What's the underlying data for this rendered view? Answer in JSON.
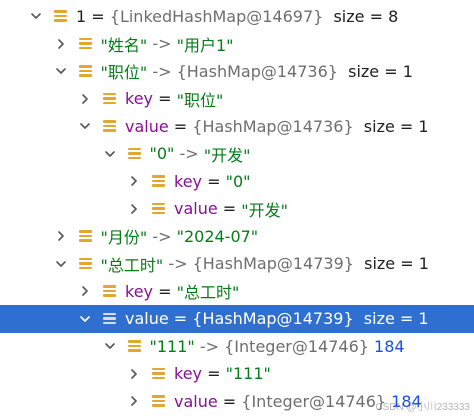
{
  "rows": [
    {
      "indent": 0,
      "expanded": true,
      "selected": false,
      "parts": [
        {
          "t": "1 = ",
          "c": "k-plain"
        },
        {
          "t": "{LinkedHashMap@14697}",
          "c": "k-gray"
        },
        {
          "t": "  size = 8",
          "c": "k-plain"
        }
      ]
    },
    {
      "indent": 1,
      "expanded": false,
      "selected": false,
      "parts": [
        {
          "t": "\"姓名\"",
          "c": "k-str"
        },
        {
          "t": " -> ",
          "c": "k-gray"
        },
        {
          "t": "\"用户1\"",
          "c": "k-str"
        }
      ]
    },
    {
      "indent": 1,
      "expanded": true,
      "selected": false,
      "parts": [
        {
          "t": "\"职位\"",
          "c": "k-str"
        },
        {
          "t": " -> ",
          "c": "k-gray"
        },
        {
          "t": "{HashMap@14736}",
          "c": "k-gray"
        },
        {
          "t": "  size = 1",
          "c": "k-plain"
        }
      ]
    },
    {
      "indent": 2,
      "expanded": false,
      "selected": false,
      "parts": [
        {
          "t": "key",
          "c": "k-key"
        },
        {
          "t": " = ",
          "c": "k-plain"
        },
        {
          "t": "\"职位\"",
          "c": "k-str"
        }
      ]
    },
    {
      "indent": 2,
      "expanded": true,
      "selected": false,
      "parts": [
        {
          "t": "value",
          "c": "k-key"
        },
        {
          "t": " = ",
          "c": "k-plain"
        },
        {
          "t": "{HashMap@14736}",
          "c": "k-gray"
        },
        {
          "t": "  size = 1",
          "c": "k-plain"
        }
      ]
    },
    {
      "indent": 3,
      "expanded": true,
      "selected": false,
      "parts": [
        {
          "t": "\"0\"",
          "c": "k-str"
        },
        {
          "t": " -> ",
          "c": "k-gray"
        },
        {
          "t": "\"开发\"",
          "c": "k-str"
        }
      ]
    },
    {
      "indent": 4,
      "expanded": false,
      "selected": false,
      "parts": [
        {
          "t": "key",
          "c": "k-key"
        },
        {
          "t": " = ",
          "c": "k-plain"
        },
        {
          "t": "\"0\"",
          "c": "k-str"
        }
      ]
    },
    {
      "indent": 4,
      "expanded": false,
      "selected": false,
      "parts": [
        {
          "t": "value",
          "c": "k-key"
        },
        {
          "t": " = ",
          "c": "k-plain"
        },
        {
          "t": "\"开发\"",
          "c": "k-str"
        }
      ]
    },
    {
      "indent": 1,
      "expanded": false,
      "selected": false,
      "parts": [
        {
          "t": "\"月份\"",
          "c": "k-str"
        },
        {
          "t": " -> ",
          "c": "k-gray"
        },
        {
          "t": "\"2024-07\"",
          "c": "k-str"
        }
      ]
    },
    {
      "indent": 1,
      "expanded": true,
      "selected": false,
      "parts": [
        {
          "t": "\"总工时\"",
          "c": "k-str"
        },
        {
          "t": " -> ",
          "c": "k-gray"
        },
        {
          "t": "{HashMap@14739}",
          "c": "k-gray"
        },
        {
          "t": "  size = 1",
          "c": "k-plain"
        }
      ]
    },
    {
      "indent": 2,
      "expanded": false,
      "selected": false,
      "parts": [
        {
          "t": "key",
          "c": "k-key"
        },
        {
          "t": " = ",
          "c": "k-plain"
        },
        {
          "t": "\"总工时\"",
          "c": "k-str"
        }
      ]
    },
    {
      "indent": 2,
      "expanded": true,
      "selected": true,
      "parts": [
        {
          "t": "value",
          "c": "k-key"
        },
        {
          "t": " = ",
          "c": "k-plain"
        },
        {
          "t": "{HashMap@14739}",
          "c": "k-gray"
        },
        {
          "t": "  size = 1",
          "c": "k-plain"
        }
      ]
    },
    {
      "indent": 3,
      "expanded": true,
      "selected": false,
      "parts": [
        {
          "t": "\"111\"",
          "c": "k-str"
        },
        {
          "t": " -> ",
          "c": "k-gray"
        },
        {
          "t": "{Integer@14746}",
          "c": "k-gray"
        },
        {
          "t": " 184",
          "c": "k-num"
        }
      ]
    },
    {
      "indent": 4,
      "expanded": false,
      "selected": false,
      "parts": [
        {
          "t": "key",
          "c": "k-key"
        },
        {
          "t": " = ",
          "c": "k-plain"
        },
        {
          "t": "\"111\"",
          "c": "k-str"
        }
      ]
    },
    {
      "indent": 4,
      "expanded": false,
      "selected": false,
      "parts": [
        {
          "t": "value",
          "c": "k-key"
        },
        {
          "t": " = ",
          "c": "k-plain"
        },
        {
          "t": "{Integer@14746}",
          "c": "k-gray"
        },
        {
          "t": " 184",
          "c": "k-num"
        }
      ]
    }
  ],
  "icons": {
    "expanded": "chevron-down-icon",
    "collapsed": "chevron-right-icon",
    "node": "field-icon"
  },
  "colors": {
    "selection": "#2f6fcf",
    "node_icon": "#e3a72f",
    "key": "#871094",
    "string": "#067d17",
    "number": "#1750eb"
  },
  "watermark": "CSDN @小川233333"
}
